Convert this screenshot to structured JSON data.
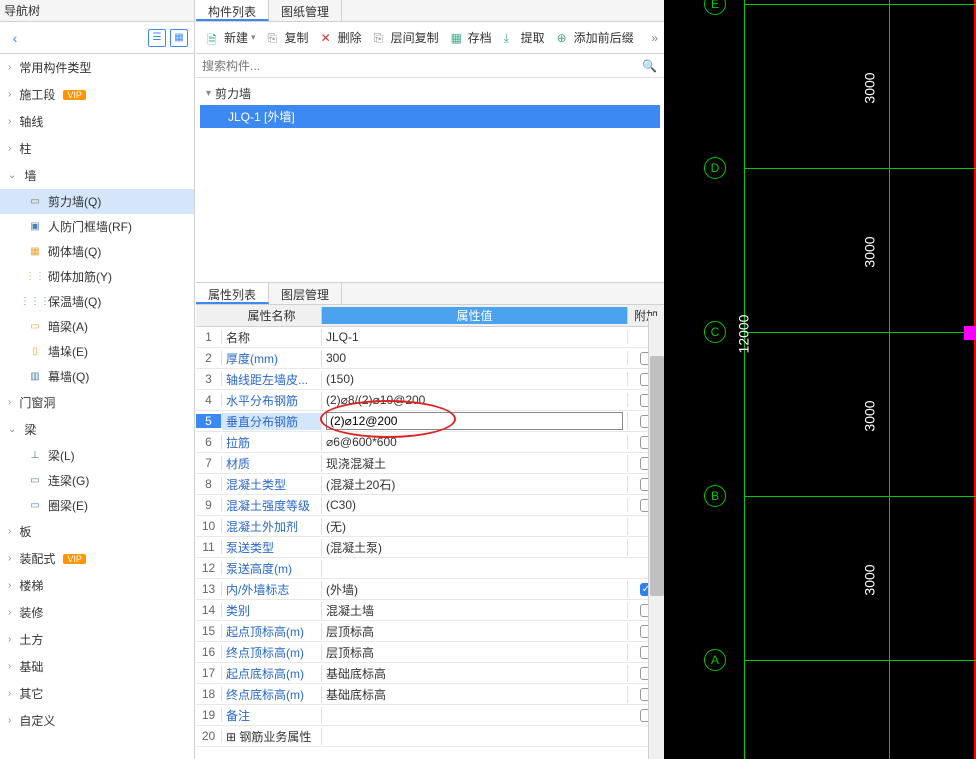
{
  "nav": {
    "title": "导航树",
    "sections": {
      "common": "常用构件类型",
      "construction": "施工段",
      "axis": "轴线",
      "column": "柱",
      "wall": "墙",
      "opening": "门窗洞",
      "beam": "梁",
      "slab": "板",
      "prefab": "装配式",
      "stair": "楼梯",
      "decorate": "装修",
      "earth": "土方",
      "foundation": "基础",
      "other": "其它",
      "custom": "自定义"
    },
    "wall_items": {
      "shear": "剪力墙(Q)",
      "rf": "人防门框墙(RF)",
      "masonry": "砌体墙(Q)",
      "reinf": "砌体加筋(Y)",
      "insul": "保温墙(Q)",
      "dark": "暗梁(A)",
      "duo": "墙垛(E)",
      "curtain": "幕墙(Q)"
    },
    "beam_items": {
      "beam": "梁(L)",
      "link": "连梁(G)",
      "ring": "圈梁(E)"
    },
    "vip": "VIP"
  },
  "comp": {
    "tabs": {
      "list": "构件列表",
      "dwg": "图纸管理"
    },
    "toolbar": {
      "new": "新建",
      "copy": "复制",
      "delete": "删除",
      "floorcopy": "层间复制",
      "archive": "存档",
      "extract": "提取",
      "prefix": "添加前后缀"
    },
    "search_ph": "搜索构件...",
    "tree": {
      "root": "剪力墙",
      "item1": "JLQ-1 [外墙]"
    }
  },
  "prop": {
    "tabs": {
      "list": "属性列表",
      "layer": "图层管理"
    },
    "headers": {
      "name": "属性名称",
      "value": "属性值",
      "attach": "附加"
    },
    "rows": [
      {
        "n": "1",
        "name": "名称",
        "val": "JLQ-1",
        "link": false,
        "chk": null
      },
      {
        "n": "2",
        "name": "厚度(mm)",
        "val": "300",
        "link": true,
        "chk": false
      },
      {
        "n": "3",
        "name": "轴线距左墙皮...",
        "val": "(150)",
        "link": true,
        "chk": false
      },
      {
        "n": "4",
        "name": "水平分布钢筋",
        "val": "(2)⌀8/(2)⌀10@200",
        "link": true,
        "chk": false
      },
      {
        "n": "5",
        "name": "垂直分布钢筋",
        "val": "(2)⌀12@200",
        "link": true,
        "chk": false,
        "edit": true,
        "sel": true
      },
      {
        "n": "6",
        "name": "拉筋",
        "val": "⌀6@600*600",
        "link": true,
        "chk": false
      },
      {
        "n": "7",
        "name": "材质",
        "val": "现浇混凝土",
        "link": true,
        "chk": false
      },
      {
        "n": "8",
        "name": "混凝土类型",
        "val": "(混凝土20石)",
        "link": true,
        "chk": false
      },
      {
        "n": "9",
        "name": "混凝土强度等级",
        "val": "(C30)",
        "link": true,
        "chk": false
      },
      {
        "n": "10",
        "name": "混凝土外加剂",
        "val": "(无)",
        "link": true,
        "chk": null
      },
      {
        "n": "11",
        "name": "泵送类型",
        "val": "(混凝土泵)",
        "link": true,
        "chk": null
      },
      {
        "n": "12",
        "name": "泵送高度(m)",
        "val": "",
        "link": true,
        "chk": null
      },
      {
        "n": "13",
        "name": "内/外墙标志",
        "val": "(外墙)",
        "link": true,
        "chk": true
      },
      {
        "n": "14",
        "name": "类别",
        "val": "混凝土墙",
        "link": true,
        "chk": false
      },
      {
        "n": "15",
        "name": "起点顶标高(m)",
        "val": "层顶标高",
        "link": true,
        "chk": false
      },
      {
        "n": "16",
        "name": "终点顶标高(m)",
        "val": "层顶标高",
        "link": true,
        "chk": false
      },
      {
        "n": "17",
        "name": "起点底标高(m)",
        "val": "基础底标高",
        "link": true,
        "chk": false
      },
      {
        "n": "18",
        "name": "终点底标高(m)",
        "val": "基础底标高",
        "link": true,
        "chk": false
      },
      {
        "n": "19",
        "name": "备注",
        "val": "",
        "link": true,
        "chk": false
      },
      {
        "n": "20",
        "name": "钢筋业务属性",
        "val": "",
        "link": false,
        "chk": null,
        "expand": true
      }
    ]
  },
  "cad": {
    "axes": [
      "E",
      "D",
      "C",
      "B",
      "A"
    ],
    "dim": "3000",
    "dim_total": "12000"
  }
}
